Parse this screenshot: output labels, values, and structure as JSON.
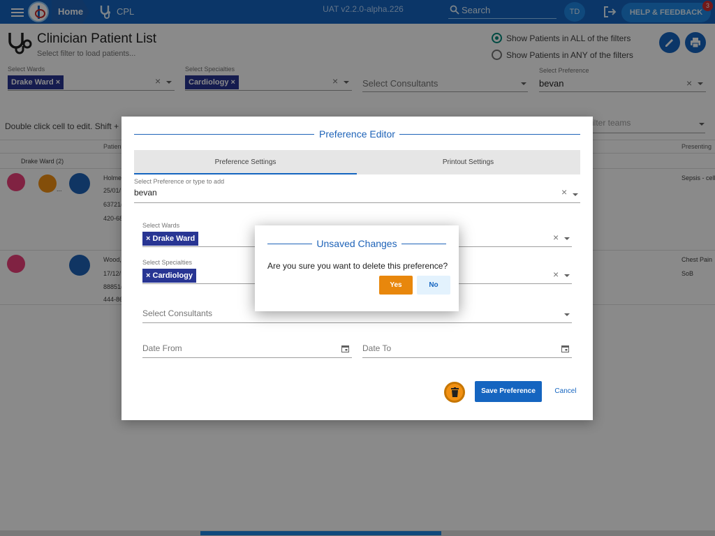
{
  "topbar": {
    "home_label": "Home",
    "app_label": "CPL",
    "version": "UAT v2.2.0-alpha.226",
    "search_placeholder": "Search",
    "user_initials": "TD",
    "help_label": "HELP & FEEDBACK",
    "notification_count": "3",
    "color": "#1565c0"
  },
  "header": {
    "title": "Clinician Patient List",
    "subtitle": "Select filter to load patients...",
    "filter_all_label": "Show Patients in ALL of the filters",
    "filter_any_label": "Show Patients in ANY of the filters",
    "filter_mode_selected": "all"
  },
  "filters": {
    "wards_label": "Select Wards",
    "wards_chip": "Drake Ward",
    "specialties_label": "Select Specialties",
    "specialties_chip": "Cardiology",
    "consultants_placeholder": "Select Consultants",
    "preference_label": "Select Preference",
    "preference_value": "bevan"
  },
  "grid": {
    "hint": "Double click cell to edit. Shift +",
    "filter_teams_placeholder": "ilter teams",
    "columns": [
      "Patien",
      "Presenting"
    ],
    "group_label": "Drake Ward (2)",
    "rows": [
      {
        "name": "Holme",
        "dob": "25/01/",
        "id": "63721(",
        "phone": "420-68",
        "presenting": "Sepsis - cell"
      },
      {
        "name": "Wood,",
        "dob": "17/12/",
        "id": "88851(",
        "phone": "444-86",
        "presenting": "Chest Pain",
        "presenting2": "SoB"
      }
    ],
    "row1_extra": "..."
  },
  "editor": {
    "title": "Preference Editor",
    "tabs": [
      {
        "label": "Preference Settings",
        "active": true
      },
      {
        "label": "Printout Settings",
        "active": false
      }
    ],
    "pref_label": "Select Preference or type to add",
    "pref_value": "bevan",
    "wards_label": "Select Wards",
    "wards_chip": "Drake Ward",
    "specialties_label": "Select Specialties",
    "specialties_chip": "Cardiology",
    "consultants_placeholder": "Select Consultants",
    "date_from_placeholder": "Date From",
    "date_to_placeholder": "Date To",
    "save_label": "Save Preference",
    "cancel_label": "Cancel"
  },
  "confirm": {
    "title": "Unsaved Changes",
    "message": "Are you sure you want to delete this preference?",
    "yes_label": "Yes",
    "no_label": "No",
    "yes_color": "#e8870c"
  },
  "icons": [
    "menu-icon",
    "logo-icon",
    "stethoscope-icon",
    "search-icon",
    "logout-icon",
    "edit-icon",
    "print-icon",
    "close-icon",
    "chevron-down-icon",
    "calendar-icon",
    "trash-icon",
    "female-icon",
    "bed-icon"
  ]
}
